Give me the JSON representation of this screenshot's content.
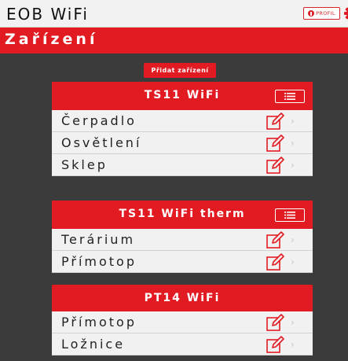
{
  "app": {
    "title": "EOB WiFi",
    "profile_label": "PROFIL"
  },
  "section": {
    "title": "Zařízení"
  },
  "toolbar": {
    "add_label": "Přidat zařízení"
  },
  "colors": {
    "accent": "#e21b23",
    "background": "#3b3b3b",
    "row_bg": "#f1f1f1"
  },
  "icons": {
    "profile": "person-info-icon",
    "settings": "gear-icon",
    "menu": "list-icon",
    "edit": "pencil-square-icon",
    "chevron": "chevron-right-icon"
  },
  "groups": [
    {
      "title": "TS11 WiFi",
      "items": [
        {
          "label": "Čerpadlo"
        },
        {
          "label": "Osvětlení"
        },
        {
          "label": "Sklep"
        }
      ]
    },
    {
      "title": "TS11 WiFi therm",
      "items": [
        {
          "label": "Terárium"
        },
        {
          "label": "Přímotop"
        }
      ]
    },
    {
      "title": "PT14 WiFi",
      "items": [
        {
          "label": "Přímotop"
        },
        {
          "label": "Ložnice"
        }
      ]
    }
  ]
}
